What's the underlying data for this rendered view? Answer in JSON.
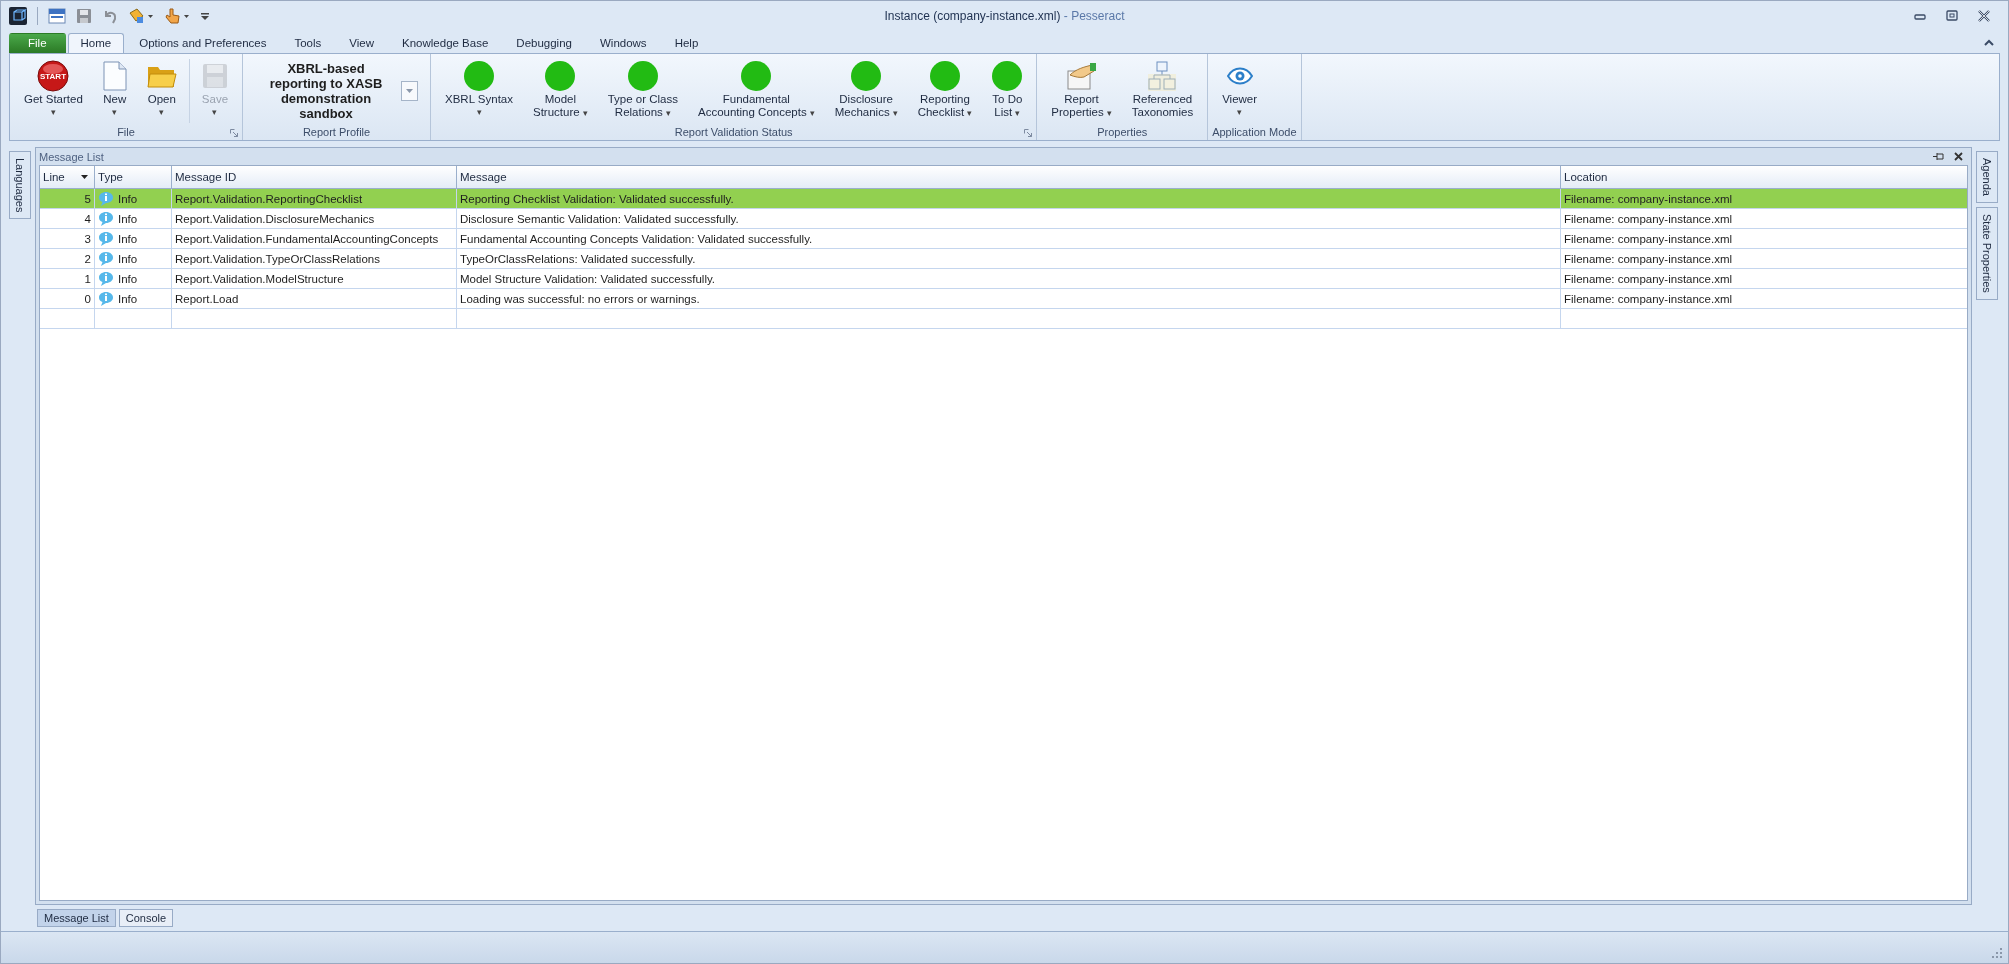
{
  "window": {
    "title": "Instance (company-instance.xml)",
    "app_name": "- Pesseract"
  },
  "ribbon_tabs": [
    {
      "label": "File",
      "kind": "file",
      "selected": false
    },
    {
      "label": "Home",
      "kind": "tab",
      "selected": true
    },
    {
      "label": "Options and Preferences",
      "kind": "tab",
      "selected": false
    },
    {
      "label": "Tools",
      "kind": "tab",
      "selected": false
    },
    {
      "label": "View",
      "kind": "tab",
      "selected": false
    },
    {
      "label": "Knowledge Base",
      "kind": "tab",
      "selected": false
    },
    {
      "label": "Debugging",
      "kind": "tab",
      "selected": false
    },
    {
      "label": "Windows",
      "kind": "tab",
      "selected": false
    },
    {
      "label": "Help",
      "kind": "tab",
      "selected": false
    }
  ],
  "ribbon_groups": [
    {
      "label": "File",
      "launcher": true,
      "buttons": [
        {
          "label": "Get Started",
          "icon_label": "START",
          "dropdown": "▾",
          "dropdown_below": true,
          "disabled": false
        },
        {
          "label": "New",
          "dropdown": "▾",
          "dropdown_below": true,
          "disabled": false
        },
        {
          "label": "Open",
          "dropdown": "▾",
          "dropdown_below": true,
          "disabled": false
        },
        {
          "label": "Save",
          "dropdown": "▾",
          "dropdown_below": true,
          "disabled": true
        }
      ]
    },
    {
      "label": "Report Profile",
      "launcher": false,
      "profile": "XBRL-based reporting to XASB demonstration sandbox"
    },
    {
      "label": "Report Validation Status",
      "launcher": true,
      "buttons": [
        {
          "label": "XBRL Syntax",
          "dropdown": "▾",
          "dropdown_below": true,
          "disabled": false
        },
        {
          "label": "Model\nStructure",
          "dropdown": "▾",
          "dropdown_below": false,
          "disabled": false
        },
        {
          "label": "Type or Class\nRelations",
          "dropdown": "▾",
          "dropdown_below": false,
          "disabled": false
        },
        {
          "label": "Fundamental\nAccounting Concepts",
          "dropdown": "▾",
          "dropdown_below": false,
          "disabled": false
        },
        {
          "label": "Disclosure\nMechanics",
          "dropdown": "▾",
          "dropdown_below": false,
          "disabled": false
        },
        {
          "label": "Reporting\nChecklist",
          "dropdown": "▾",
          "dropdown_below": false,
          "disabled": false
        },
        {
          "label": "To Do\nList",
          "dropdown": "▾",
          "dropdown_below": false,
          "disabled": false
        }
      ]
    },
    {
      "label": "Properties",
      "launcher": false,
      "buttons": [
        {
          "label": "Report\nProperties",
          "dropdown": "▾",
          "dropdown_below": false,
          "disabled": false
        },
        {
          "label": "Referenced\nTaxonomies",
          "disabled": false
        }
      ]
    },
    {
      "label": "Application Mode",
      "launcher": false,
      "buttons": [
        {
          "label": "Viewer",
          "dropdown": "▾",
          "dropdown_below": true,
          "disabled": false
        }
      ]
    }
  ],
  "left_side_tabs": [
    "Languages"
  ],
  "right_side_tabs": [
    "Agenda",
    "State Properties"
  ],
  "message_list": {
    "title": "Message List",
    "columns": [
      "Line",
      "Type",
      "Message ID",
      "Message",
      "Location"
    ],
    "rows": [
      {
        "line": "5",
        "type": "Info",
        "message_id": "Report.Validation.ReportingChecklist",
        "message": "Reporting Checklist Validation: Validated successfully.",
        "location": "Filename: company-instance.xml",
        "selected": true
      },
      {
        "line": "4",
        "type": "Info",
        "message_id": "Report.Validation.DisclosureMechanics",
        "message": "Disclosure Semantic Validation: Validated successfully.",
        "location": "Filename: company-instance.xml",
        "selected": false
      },
      {
        "line": "3",
        "type": "Info",
        "message_id": "Report.Validation.FundamentalAccountingConcepts",
        "message": "Fundamental Accounting Concepts Validation: Validated successfully.",
        "location": "Filename: company-instance.xml",
        "selected": false
      },
      {
        "line": "2",
        "type": "Info",
        "message_id": "Report.Validation.TypeOrClassRelations",
        "message": "TypeOrClassRelations: Validated successfully.",
        "location": "Filename: company-instance.xml",
        "selected": false
      },
      {
        "line": "1",
        "type": "Info",
        "message_id": "Report.Validation.ModelStructure",
        "message": "Model Structure Validation: Validated successfully.",
        "location": "Filename: company-instance.xml",
        "selected": false
      },
      {
        "line": "0",
        "type": "Info",
        "message_id": "Report.Load",
        "message": "Loading was successful: no errors or warnings.",
        "location": "Filename: company-instance.xml",
        "selected": false
      }
    ]
  },
  "bottom_tabs": [
    {
      "label": "Message List",
      "selected": true
    },
    {
      "label": "Console",
      "selected": false
    }
  ]
}
